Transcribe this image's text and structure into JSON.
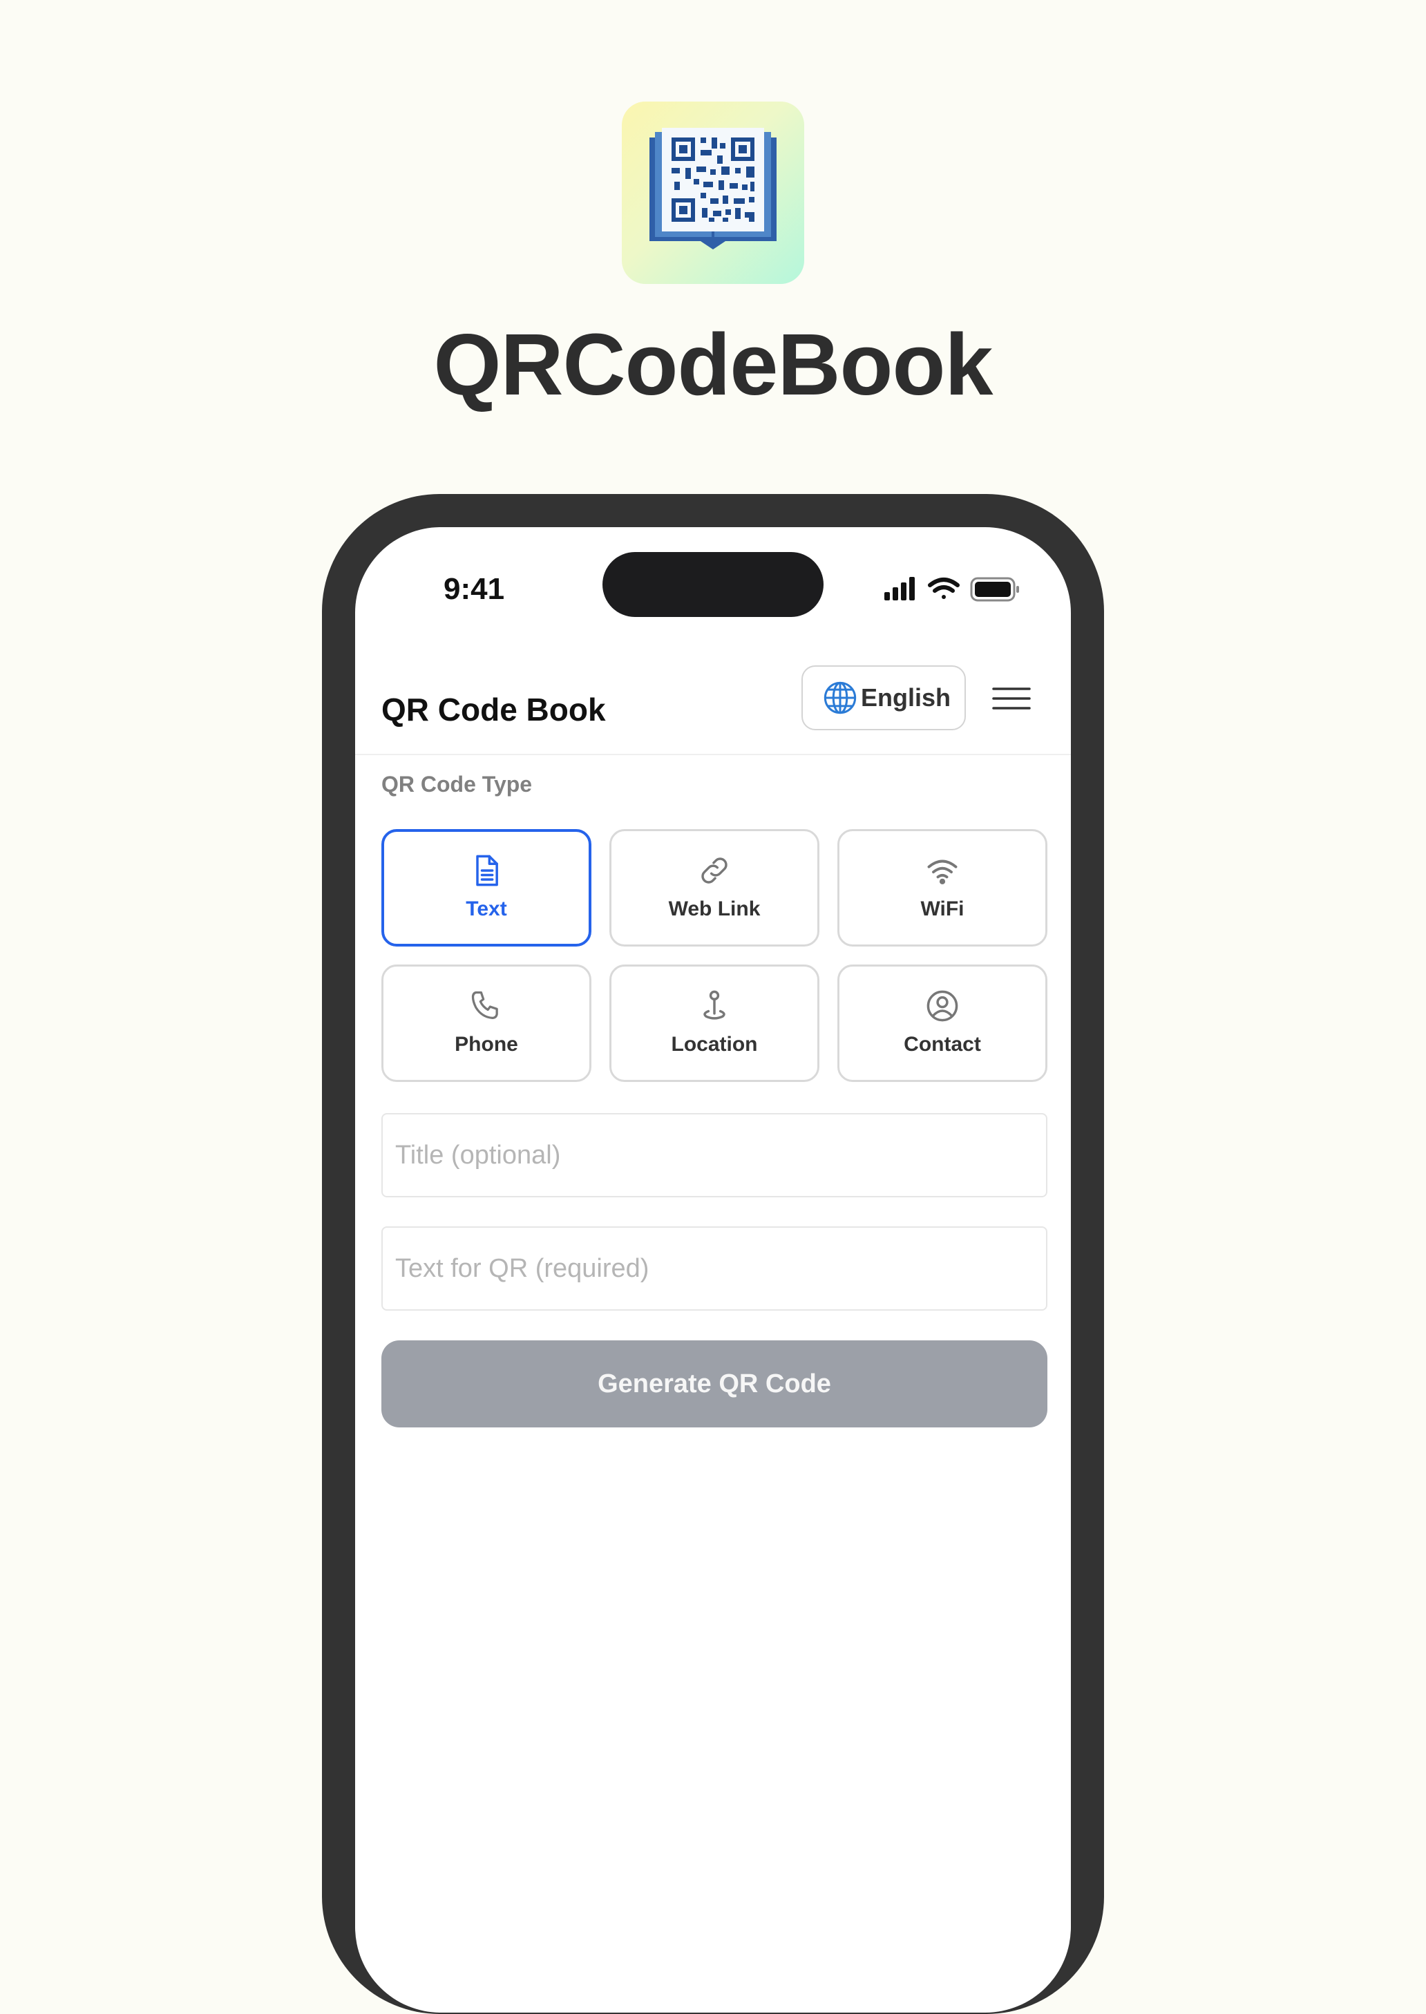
{
  "marketing": {
    "title": "QRCodeBook",
    "logo_icon": "qr-book-icon"
  },
  "status_bar": {
    "time": "9:41",
    "icons": [
      "cellular-signal-icon",
      "wifi-icon",
      "battery-icon"
    ]
  },
  "header": {
    "title": "QR Code Book",
    "language_button": {
      "icon": "globe-icon",
      "label": "English"
    },
    "menu_icon": "hamburger-menu-icon"
  },
  "qr_type": {
    "section_label": "QR Code Type",
    "selected": "Text",
    "options": [
      {
        "label": "Text",
        "icon": "document-icon"
      },
      {
        "label": "Web Link",
        "icon": "link-icon"
      },
      {
        "label": "WiFi",
        "icon": "wifi-icon"
      },
      {
        "label": "Phone",
        "icon": "phone-icon"
      },
      {
        "label": "Location",
        "icon": "map-pin-icon"
      },
      {
        "label": "Contact",
        "icon": "user-circle-icon"
      }
    ]
  },
  "form": {
    "title_placeholder": "Title (optional)",
    "text_placeholder": "Text for QR (required)",
    "title_value": "",
    "text_value": ""
  },
  "actions": {
    "generate_label": "Generate QR Code"
  },
  "colors": {
    "background": "#fcfcf5",
    "accent": "#2563eb",
    "button_disabled": "#9ca0a8",
    "phone_frame": "#333333"
  }
}
